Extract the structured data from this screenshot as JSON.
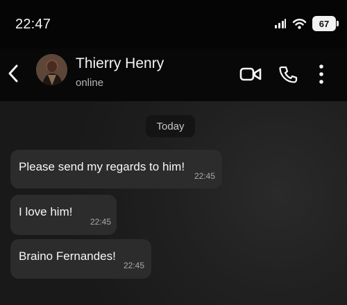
{
  "status_bar": {
    "time": "22:47",
    "battery": "67",
    "icons": [
      "signal-icon",
      "wifi-icon",
      "battery-icon"
    ]
  },
  "header": {
    "back_icon": "chevron-left-icon",
    "contact_name": "Thierry Henry",
    "contact_status": "online",
    "actions": [
      "video-camera-icon",
      "phone-icon",
      "more-vertical-icon"
    ]
  },
  "conversation": {
    "date_label": "Today",
    "messages": [
      {
        "text": "Please send my regards to him!",
        "time": "22:45"
      },
      {
        "text": "I love him!",
        "time": "22:45"
      },
      {
        "text": "Braino Fernandes!",
        "time": "22:45"
      }
    ]
  },
  "colors": {
    "background": "#0b0b0b",
    "header": "#080808",
    "chat_background": "#202020",
    "bubble": "#2c2c2c",
    "text": "#f5f5f5",
    "muted_text": "#a9a9a9"
  }
}
